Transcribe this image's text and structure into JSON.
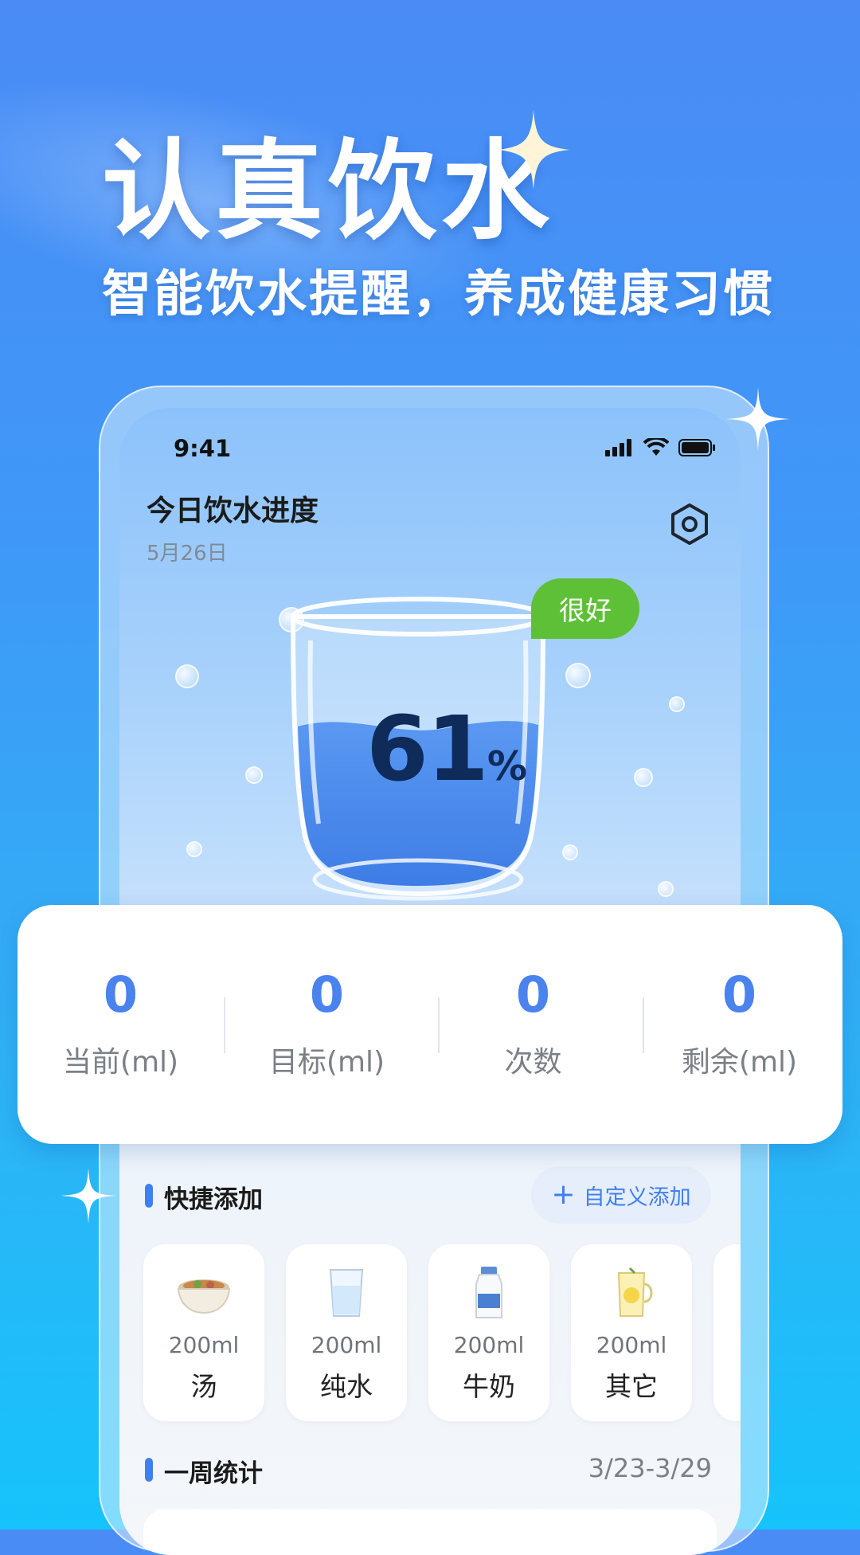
{
  "hero": {
    "title": "认真饮水",
    "subtitle": "智能饮水提醒，养成健康习惯"
  },
  "status_bar": {
    "time": "9:41"
  },
  "header": {
    "title": "今日饮水进度",
    "date": "5月26日",
    "settings_icon": "gear-icon"
  },
  "progress": {
    "percent": 61,
    "percent_number": "61",
    "percent_sign": "%",
    "badge": "很好"
  },
  "stats": [
    {
      "value": "0",
      "label": "当前(ml)"
    },
    {
      "value": "0",
      "label": "目标(ml)"
    },
    {
      "value": "0",
      "label": "次数"
    },
    {
      "value": "0",
      "label": "剩余(ml)"
    }
  ],
  "quick_add": {
    "title": "快捷添加",
    "custom_button": "自定义添加",
    "items": [
      {
        "amount": "200ml",
        "name": "汤",
        "icon": "soup-bowl-icon"
      },
      {
        "amount": "200ml",
        "name": "纯水",
        "icon": "water-glass-icon"
      },
      {
        "amount": "200ml",
        "name": "牛奶",
        "icon": "milk-bottle-icon"
      },
      {
        "amount": "200ml",
        "name": "其它",
        "icon": "lemon-drink-icon"
      }
    ]
  },
  "weekly": {
    "title": "一周统计",
    "range": "3/23-3/29"
  },
  "colors": {
    "accent": "#4a82ee",
    "badge_green": "#5ec036",
    "water_blue": "#4d8ff0"
  }
}
